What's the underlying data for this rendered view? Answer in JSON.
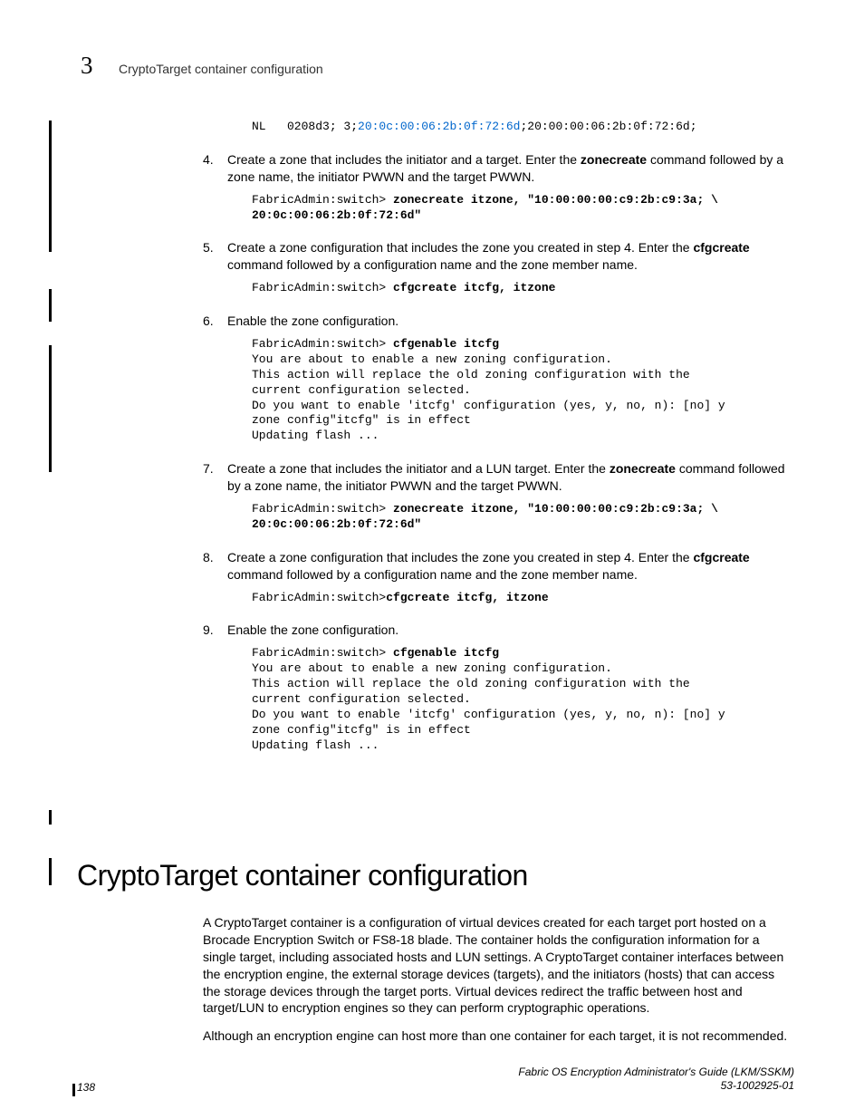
{
  "chapterNumber": "3",
  "runningHead": "CryptoTarget container configuration",
  "code0_a": "NL   0208d3; 3;",
  "code0_link": "20:0c:00:06:2b:0f:72:6d",
  "code0_b": ";20:00:00:06:2b:0f:72:6d;",
  "steps": {
    "s4": {
      "num": "4.",
      "text_a": "Create a zone that includes the initiator and a target. Enter the ",
      "bold": "zonecreate",
      "text_b": " command followed by a zone name, the initiator PWWN and the target PWWN.",
      "code_prompt": "FabricAdmin:switch> ",
      "code_cmd": "zonecreate itzone, \"10:00:00:00:c9:2b:c9:3a; \\\n20:0c:00:06:2b:0f:72:6d\""
    },
    "s5": {
      "num": "5.",
      "text_a": "Create a zone configuration that includes the zone you created in step 4. Enter the ",
      "bold": "cfgcreate",
      "text_b": " command followed by a configuration name and the zone member name.",
      "code_prompt": "FabricAdmin:switch> ",
      "code_cmd": "cfgcreate itcfg, itzone"
    },
    "s6": {
      "num": "6.",
      "text": "Enable the zone configuration.",
      "code_prompt": "FabricAdmin:switch> ",
      "code_cmd": "cfgenable itcfg",
      "code_out": "You are about to enable a new zoning configuration.\nThis action will replace the old zoning configuration with the\ncurrent configuration selected.\nDo you want to enable 'itcfg' configuration (yes, y, no, n): [no] y\nzone config\"itcfg\" is in effect\nUpdating flash ..."
    },
    "s7": {
      "num": "7.",
      "text_a": "Create a zone that includes the initiator and a LUN target. Enter the ",
      "bold": "zonecreate",
      "text_b": " command followed by a zone name, the initiator PWWN and the target PWWN.",
      "code_prompt": "FabricAdmin:switch> ",
      "code_cmd": "zonecreate itzone, \"10:00:00:00:c9:2b:c9:3a; \\\n20:0c:00:06:2b:0f:72:6d\""
    },
    "s8": {
      "num": "8.",
      "text_a": "Create a zone configuration that includes the zone you created in step 4. Enter the ",
      "bold": "cfgcreate",
      "text_b": " command followed by a configuration name and the zone member name.",
      "code_prompt": "FabricAdmin:switch>",
      "code_cmd": "cfgcreate itcfg, itzone"
    },
    "s9": {
      "num": "9.",
      "text": "Enable the zone configuration.",
      "code_prompt": "FabricAdmin:switch> ",
      "code_cmd": "cfgenable itcfg",
      "code_out": "You are about to enable a new zoning configuration.\nThis action will replace the old zoning configuration with the\ncurrent configuration selected.\nDo you want to enable 'itcfg' configuration (yes, y, no, n): [no] y\nzone config\"itcfg\" is in effect\nUpdating flash ..."
    }
  },
  "sectionHeading": "CryptoTarget container configuration",
  "para1": "A CryptoTarget container is a configuration of virtual devices created for each target port hosted on a Brocade Encryption Switch or FS8-18 blade. The container holds the configuration information for a single target, including associated hosts and LUN settings. A CryptoTarget container interfaces between the encryption engine, the external storage devices (targets), and the initiators (hosts) that can access the storage devices through the target ports. Virtual devices redirect the traffic between host and target/LUN to encryption engines so they can perform cryptographic operations.",
  "para2": "Although an encryption engine can host more than one container for each target, it is not recommended.",
  "footer": {
    "pageNum": "138",
    "title": "Fabric OS Encryption Administrator's Guide  (LKM/SSKM)",
    "docnum": "53-1002925-01"
  }
}
